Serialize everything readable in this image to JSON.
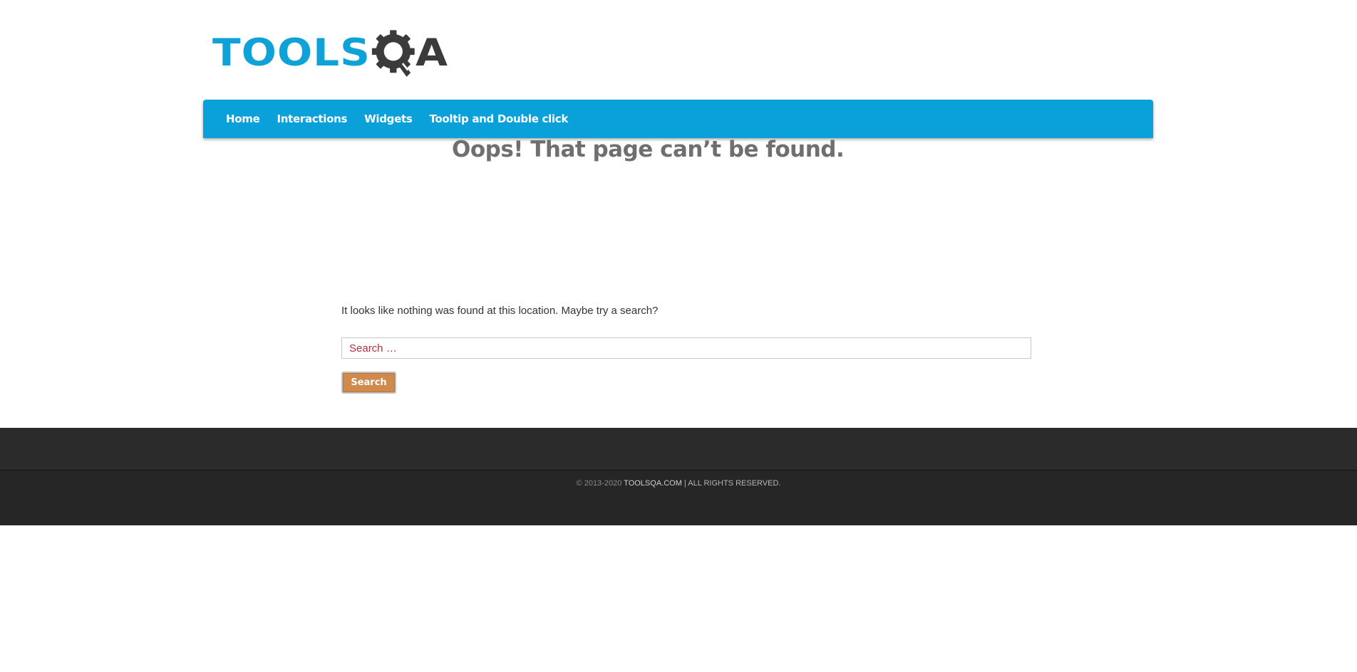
{
  "logo": {
    "part1": "TOOLS",
    "part2": "A",
    "colors": {
      "blue": "#0ea2d9",
      "dark": "#3b3b3b"
    }
  },
  "nav": {
    "items": [
      {
        "label": "Home"
      },
      {
        "label": "Interactions"
      },
      {
        "label": "Widgets"
      },
      {
        "label": "Tooltip and Double click"
      }
    ],
    "background": "#0aa1db"
  },
  "main": {
    "title": "Oops! That page can’t be found.",
    "message": "It looks like nothing was found at this location. Maybe try a search?",
    "search": {
      "placeholder": "Search …",
      "value": "",
      "button_label": "Search"
    }
  },
  "footer": {
    "copyright_prefix": "© 2013-2020 ",
    "site": "TOOLSQA.COM",
    "rights": " | ALL RIGHTS RESERVED."
  }
}
